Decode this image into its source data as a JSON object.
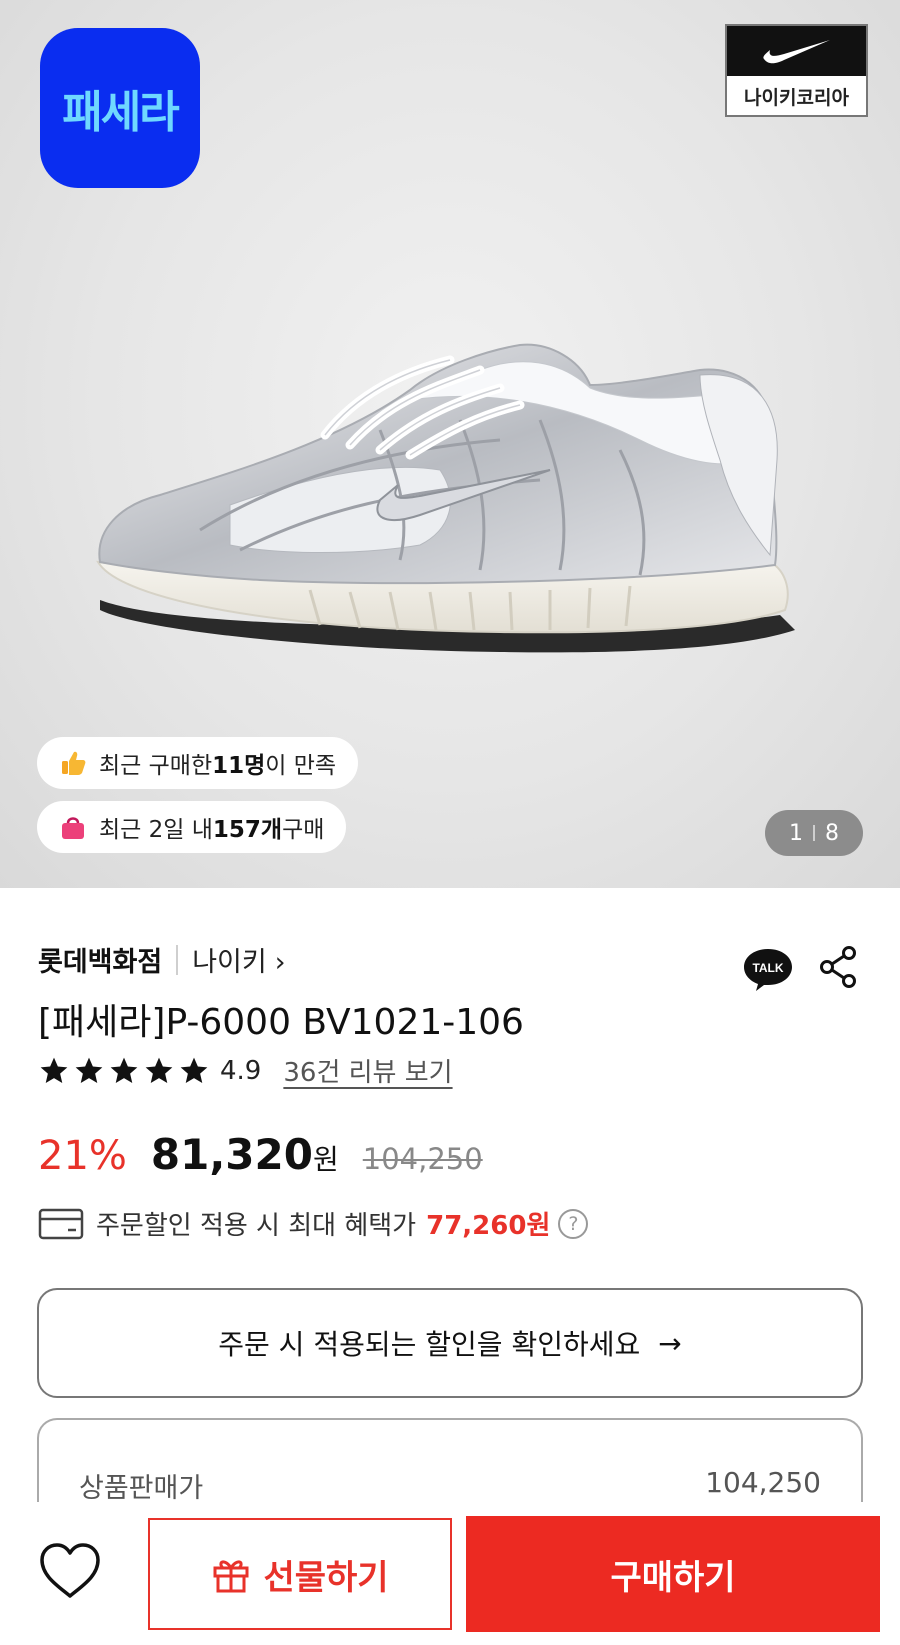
{
  "hero": {
    "brand_logo_text": "패세라",
    "nike_badge_label": "나이키코리아",
    "social_proof_1": {
      "prefix": "최근 구매한 ",
      "count": "11명",
      "suffix": "이 만족"
    },
    "social_proof_2": {
      "prefix": "최근 2일 내 ",
      "count": "157개",
      "suffix": " 구매"
    },
    "image_counter": {
      "current": "1",
      "total": "8"
    }
  },
  "product": {
    "store": "롯데백화점",
    "brand": "나이키",
    "brand_chevron": "›",
    "title": "[패세라]P-6000 BV1021-106",
    "rating": "4.9",
    "rating_stars": 5,
    "review_link": "36건 리뷰 보기",
    "talk_label": "TALK"
  },
  "price": {
    "discount_rate": "21%",
    "sale_price": "81,320",
    "currency": "원",
    "original_price": "104,250",
    "benefit_label": "주문할인 적용 시 최대 혜택가",
    "benefit_price": "77,260원",
    "help_icon": "?"
  },
  "discount_check": {
    "label": "주문 시 적용되는 할인을 확인하세요",
    "arrow": "→"
  },
  "price_detail": {
    "label": "상품판매가",
    "value": "104,250"
  },
  "bottom_bar": {
    "gift_label": "선물하기",
    "buy_label": "구매하기"
  },
  "colors": {
    "accent": "#e8322a",
    "brand_blue": "#0a2df0",
    "brand_logo_text": "#6fd8ff"
  }
}
